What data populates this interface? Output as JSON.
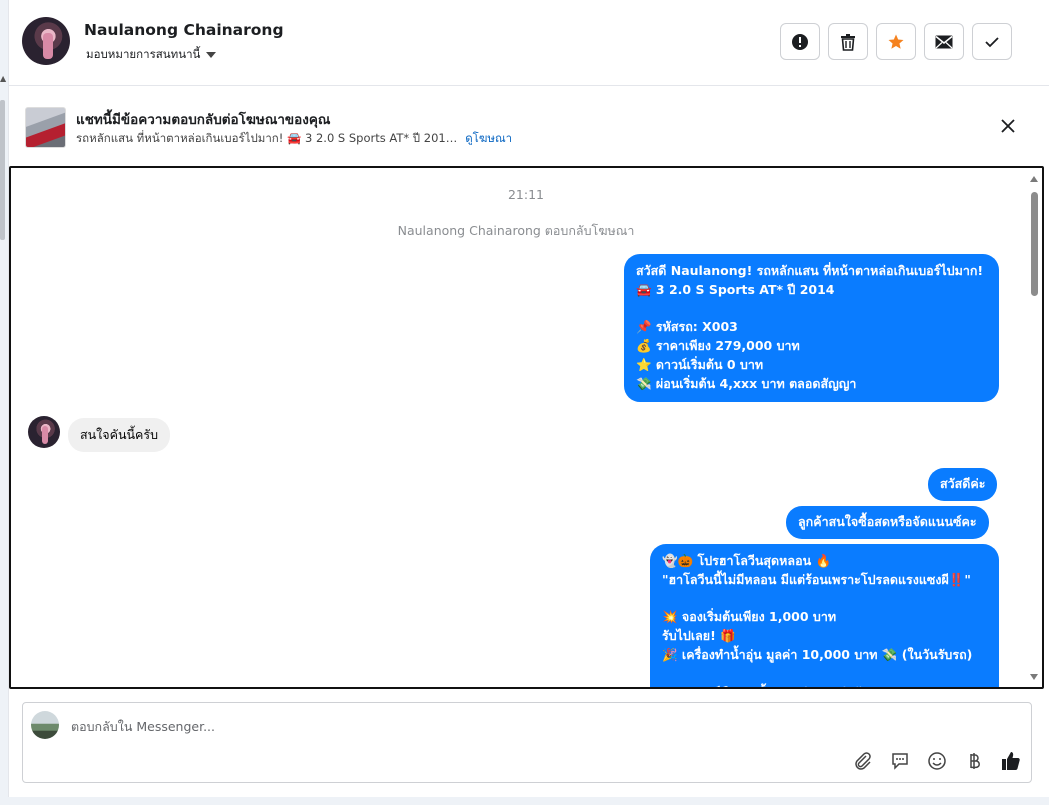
{
  "header": {
    "contact_name": "Naulanong Chainarong",
    "assign_label": "มอบหมายการสนทนานี้",
    "actions": [
      {
        "name": "spam-button",
        "icon": "exclamation-circle-icon"
      },
      {
        "name": "delete-button",
        "icon": "trash-icon"
      },
      {
        "name": "star-button",
        "icon": "star-icon",
        "color": "#f5821f"
      },
      {
        "name": "mark-unread-button",
        "icon": "envelope-icon"
      },
      {
        "name": "mark-done-button",
        "icon": "check-icon"
      }
    ]
  },
  "ad_banner": {
    "title": "แชทนี้มีข้อความตอบกลับต่อโฆษณาของคุณ",
    "subtitle": "รถหลักแสน ที่หน้าตาหล่อเกินเบอร์ไปมาก! 🚘 3 2.0 S Sports AT* ปี 201…",
    "link": "ดูโฆษณา"
  },
  "chat": {
    "timestamp": "21:11",
    "system_message": "Naulanong Chainarong ตอบกลับโฆษณา",
    "messages": [
      {
        "from": "page",
        "text": "สวัสดี Naulanong! รถหลักแสน ที่หน้าตาหล่อเกินเบอร์ไปมาก!\n🚘 3 2.0 S Sports AT* ปี 2014\n\n📌 รหัสรถ: X003\n💰 ราคาเพียง 279,000 บาท\n⭐ ดาวน์เริ่มต้น 0 บาท\n💸 ผ่อนเริ่มต้น 4,xxx บาท ตลอดสัญญา"
      },
      {
        "from": "customer",
        "text": "สนใจคันนี้ครับ"
      },
      {
        "from": "page",
        "text": "สวัสดีค่ะ"
      },
      {
        "from": "page",
        "text": "ลูกค้าสนใจซื้อสดหรือจัดแนนซ์คะ"
      },
      {
        "from": "page",
        "text": "👻🎃 โปรฮาโลวีนสุดหลอน 🔥\n\"ฮาโลวีนนี้ไม่มีหลอน มีแต่ร้อนเพราะโปรลดแรงแซงผี‼️\"\n\n💥 จองเริ่มต้นเพียง 1,000 บาท\nรับไปเลย! 🎁\n🎉 เครื่องทำน้ำอุ่น มูลค่า 10,000 บาท 💸 (ในวันรับรถ)\n\n🚗 รถยนต์มือสองทั้งหมด จำนวนจำกัด"
      }
    ]
  },
  "composer": {
    "placeholder": "ตอบกลับใน Messenger...",
    "tools": [
      "paperclip-icon",
      "chat-bubble-icon",
      "emoji-icon",
      "baht-icon",
      "thumbs-up-icon"
    ]
  },
  "colors": {
    "accent": "#0a7cff",
    "star": "#f5821f"
  }
}
